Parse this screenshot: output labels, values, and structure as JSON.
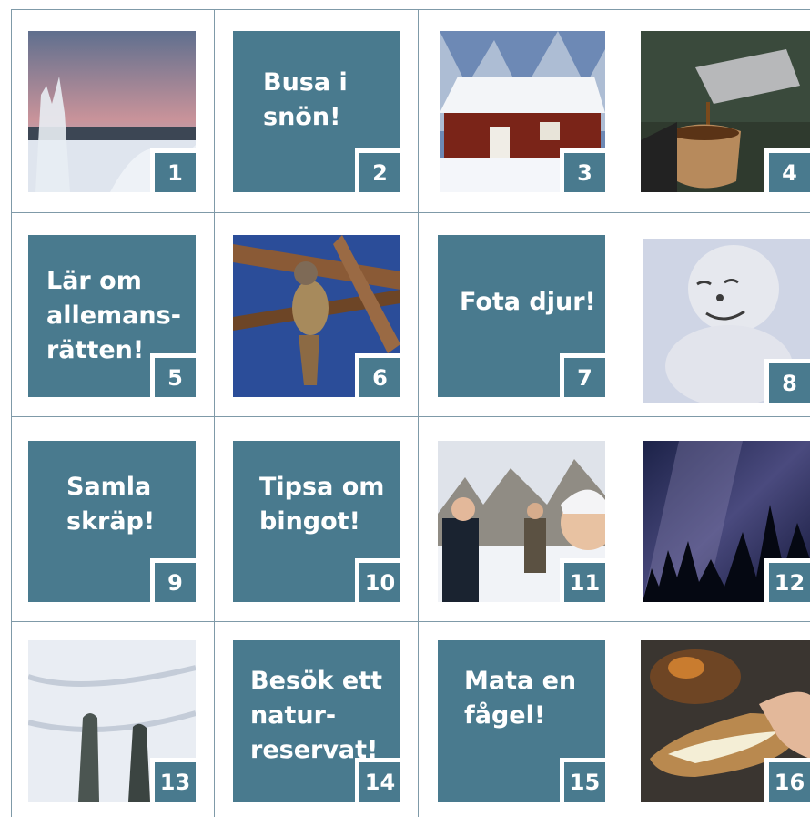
{
  "tiles": [
    {
      "number": "1",
      "label": "",
      "kind": "photo",
      "scene": "winter-sunset"
    },
    {
      "number": "2",
      "label": "Busa i\nsnön!",
      "kind": "text"
    },
    {
      "number": "3",
      "label": "",
      "kind": "photo",
      "scene": "red-cabin-snow"
    },
    {
      "number": "4",
      "label": "",
      "kind": "photo",
      "scene": "thermos-cup"
    },
    {
      "number": "5",
      "label": "Lär om\nallemans-\nrätten!",
      "kind": "text"
    },
    {
      "number": "6",
      "label": "",
      "kind": "photo",
      "scene": "bird-branch"
    },
    {
      "number": "7",
      "label": "Fota djur!",
      "kind": "text"
    },
    {
      "number": "8",
      "label": "",
      "kind": "photo",
      "scene": "snowman"
    },
    {
      "number": "9",
      "label": "Samla\nskräp!",
      "kind": "text"
    },
    {
      "number": "10",
      "label": "Tipsa om\nbingot!",
      "kind": "text"
    },
    {
      "number": "11",
      "label": "",
      "kind": "photo",
      "scene": "people-selfie-snow"
    },
    {
      "number": "12",
      "label": "",
      "kind": "photo",
      "scene": "starry-sky-forest"
    },
    {
      "number": "13",
      "label": "",
      "kind": "photo",
      "scene": "skis-snow"
    },
    {
      "number": "14",
      "label": "Besök ett\nnatur-\nreservat!",
      "kind": "text"
    },
    {
      "number": "15",
      "label": "Mata en\nfågel!",
      "kind": "text"
    },
    {
      "number": "16",
      "label": "",
      "kind": "photo",
      "scene": "campfire-bread"
    }
  ],
  "colors": {
    "tile": "#497a8e",
    "grid": "#7f9aa8",
    "background": "#ffffff"
  }
}
